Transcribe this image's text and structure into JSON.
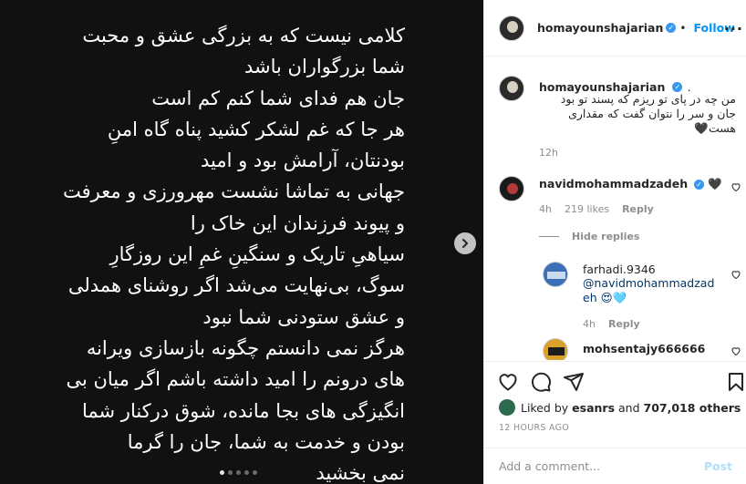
{
  "post": {
    "image_text": "کلامی نیست که به بزرگی عشق و محبت\nشما بزرگواران باشد\nجان هم فدای شما کنم کم است\nهر جا که غم لشکر کشید پناه گاه امنِ\nبودنتان، آرامش بود و امید\nجهانی به تماشا نشست مهرورزی و معرفت\nو پیوند فرزندان این خاک را\nسیاهیِ تاریک و سنگینِ غمِ این روزگارِ\nسوگ، بی‌نهایت می‌شد اگر روشنای همدلی\nو عشق ستودنی شما نبود\nهرگز نمی دانستم چگونه بازسازی ویرانه\nهای درونم را امید داشته باشم اگر میان بی\nانگیزگی های بجا مانده، شوق درکنار شما\nبودن و خدمت به شما، جان را گرما\nنمی بخشید",
    "carousel_dots": 5,
    "active_dot": 0
  },
  "header": {
    "username": "homayounshajarian",
    "follow_label": "Follow",
    "separator": "•"
  },
  "caption": {
    "username": "homayounshajarian",
    "suffix": ".",
    "text": "من چه در پای تو ریزم که پسند تو بود\nجان و سر را نتوان گفت که مقداری\nهست🖤",
    "time": "12h"
  },
  "comments": [
    {
      "username": "navidmohammadzadeh",
      "text": "🖤",
      "time": "4h",
      "likes": "219 likes",
      "reply_label": "Reply"
    }
  ],
  "hide_replies_label": "Hide replies",
  "replies": [
    {
      "username": "farhadi.9346",
      "text": "@navidmohammadzad\neh 😍🩵",
      "time": "4h",
      "reply_label": "Reply"
    },
    {
      "username": "mohsentajy666666"
    }
  ],
  "likes": {
    "prefix": "Liked by",
    "user": "esanrs",
    "middle": "and",
    "count": "707,018 others"
  },
  "timestamp": "12 HOURS AGO",
  "add_comment": {
    "placeholder": "Add a comment...",
    "post_label": "Post"
  },
  "colors": {
    "accent": "#0095f6",
    "verified": "#3897f0",
    "media_bg": "#111111"
  }
}
